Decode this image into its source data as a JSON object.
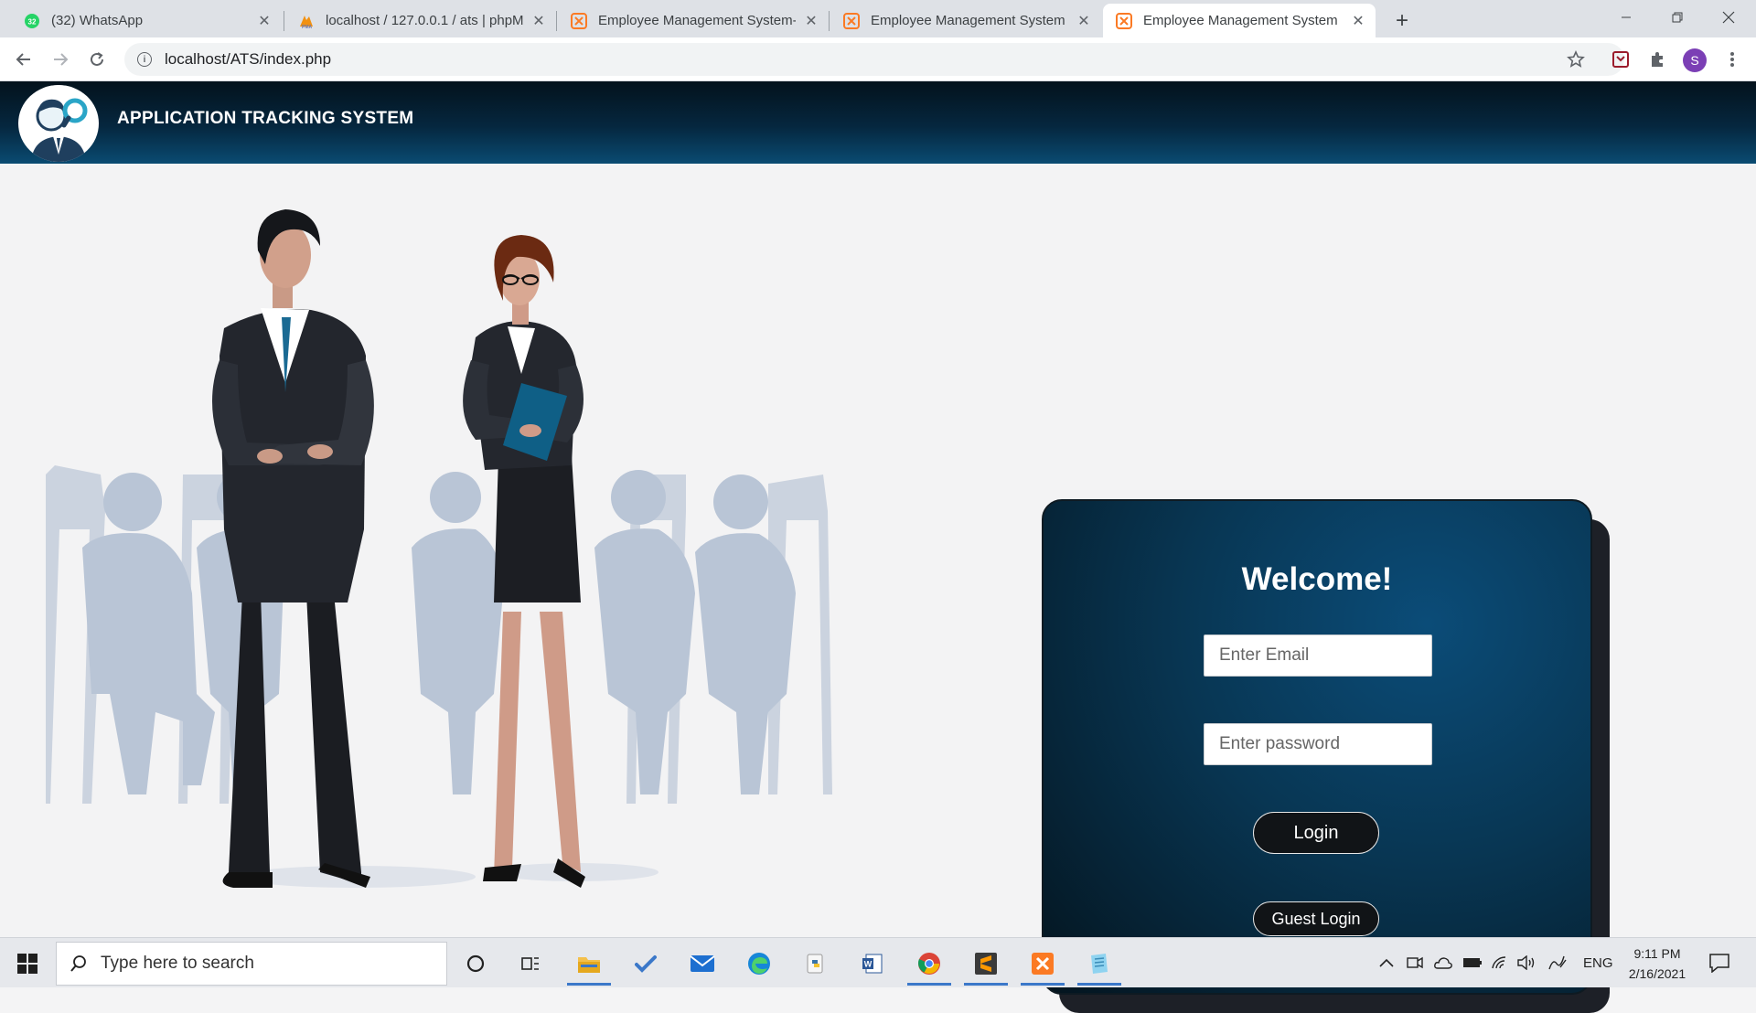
{
  "browser": {
    "tabs": [
      {
        "title": "(32) WhatsApp",
        "badge": "32",
        "favicon": "whatsapp-icon",
        "active": false
      },
      {
        "title": "localhost / 127.0.0.1 / ats | phpM",
        "favicon": "phpmyadmin-icon",
        "active": false
      },
      {
        "title": "Employee Management System-I",
        "favicon": "xampp-icon",
        "active": false
      },
      {
        "title": "Employee Management System",
        "favicon": "xampp-icon",
        "active": false
      },
      {
        "title": "Employee Management System",
        "favicon": "xampp-icon",
        "active": true
      }
    ],
    "url": "localhost/ATS/index.php",
    "profile_initial": "S"
  },
  "site": {
    "title": "APPLICATION TRACKING SYSTEM"
  },
  "login": {
    "heading": "Welcome!",
    "email_placeholder": "Enter Email",
    "password_placeholder": "Enter password",
    "login_label": "Login",
    "guest_label": "Guest Login"
  },
  "taskbar": {
    "search_placeholder": "Type here to search",
    "language": "ENG",
    "time": "9:11 PM",
    "date": "2/16/2021",
    "apps": [
      "file-explorer-icon",
      "todo-icon",
      "mail-icon",
      "edge-icon",
      "python-icon",
      "word-icon",
      "chrome-icon",
      "sublime-icon",
      "xampp-icon",
      "notepad-icon"
    ]
  },
  "colors": {
    "header_dark": "#04121c",
    "header_blue": "#0a4b72",
    "card_blue": "#0b4c78",
    "accent_teal": "#0b6a8a"
  }
}
